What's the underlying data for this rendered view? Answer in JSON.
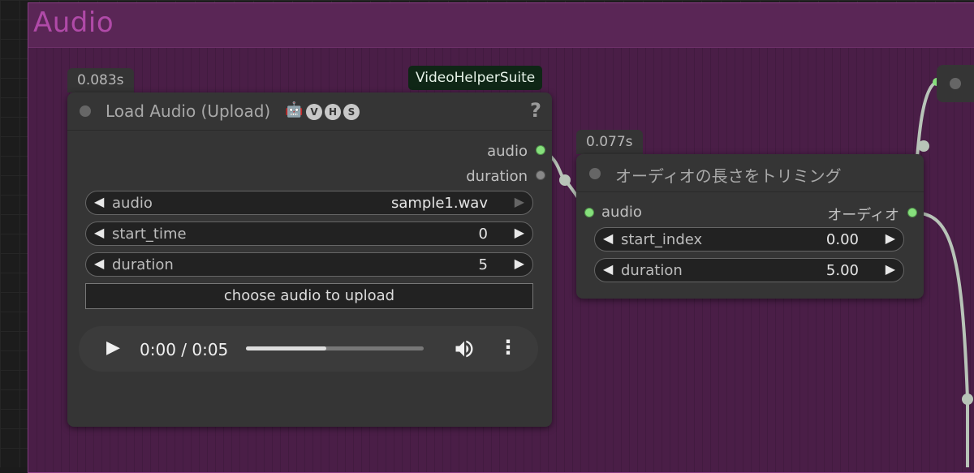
{
  "group": {
    "title": "Audio"
  },
  "load_audio_node": {
    "exec_time": "0.083s",
    "suite_badge": "VideoHelperSuite",
    "title": "Load Audio (Upload)",
    "title_icon": "robot-icon",
    "tags": [
      "V",
      "H",
      "S"
    ],
    "help": "?",
    "outputs": [
      {
        "label": "audio",
        "color": "#86e07c"
      },
      {
        "label": "duration",
        "color": "#888888"
      }
    ],
    "widgets": [
      {
        "label": "audio",
        "value": "sample1.wav"
      },
      {
        "label": "start_time",
        "value": "0"
      },
      {
        "label": "duration",
        "value": "5"
      }
    ],
    "upload_button": "choose audio to upload",
    "player": {
      "time": "0:00 / 0:05",
      "progress": 0.45,
      "play_icon": "play-icon",
      "volume_icon": "volume-icon",
      "menu_icon": "more-vert-icon"
    }
  },
  "trim_node": {
    "exec_time": "0.077s",
    "title": "オーディオの長さをトリミング",
    "input": {
      "label": "audio",
      "color": "#86e07c"
    },
    "output": {
      "label": "オーディオ",
      "color": "#86e07c"
    },
    "widgets": [
      {
        "label": "start_index",
        "value": "0.00"
      },
      {
        "label": "duration",
        "value": "5.00"
      }
    ]
  },
  "colors": {
    "group_bg": "#4a1e47",
    "group_title": "#b04aa8",
    "node_bg": "#353535",
    "link": "#b8c4b8",
    "slot_green": "#86e07c"
  }
}
